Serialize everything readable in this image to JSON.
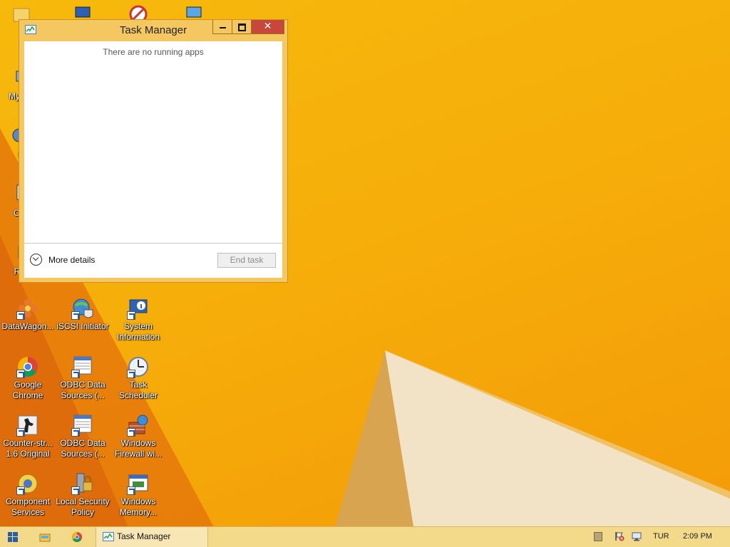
{
  "window": {
    "title": "Task Manager",
    "empty_message": "There are no running apps",
    "more_details_label": "More details",
    "end_task_label": "End task"
  },
  "desktop": {
    "partial_labels": [
      "My C",
      "N",
      "Con",
      "Rec"
    ],
    "icons": [
      {
        "label": "DataWagon...",
        "icon": "flower-app-icon"
      },
      {
        "label": "iSCSI Initiator",
        "icon": "globe-shield-icon"
      },
      {
        "label": "System Information",
        "icon": "system-info-icon"
      },
      {
        "label": "Google Chrome",
        "icon": "chrome-icon"
      },
      {
        "label": "ODBC Data Sources (...",
        "icon": "odbc-icon"
      },
      {
        "label": "Task Scheduler",
        "icon": "clock-icon"
      },
      {
        "label": "Counter-str... 1.6 Original",
        "icon": "game-icon"
      },
      {
        "label": "ODBC Data Sources (...",
        "icon": "odbc-icon"
      },
      {
        "label": "Windows Firewall wi...",
        "icon": "firewall-icon"
      },
      {
        "label": "Component Services",
        "icon": "components-icon"
      },
      {
        "label": "Local Security Policy",
        "icon": "security-policy-icon"
      },
      {
        "label": "Windows Memory...",
        "icon": "memory-diagnostic-icon"
      }
    ]
  },
  "taskbar": {
    "task_label": "Task Manager",
    "language": "TUR",
    "clock": "2:09 PM"
  },
  "colors": {
    "wallpaper": "#f6ae0a",
    "window_frame": "#f5c760",
    "close_button": "#c7473a",
    "taskbar": "#f3d98a"
  }
}
